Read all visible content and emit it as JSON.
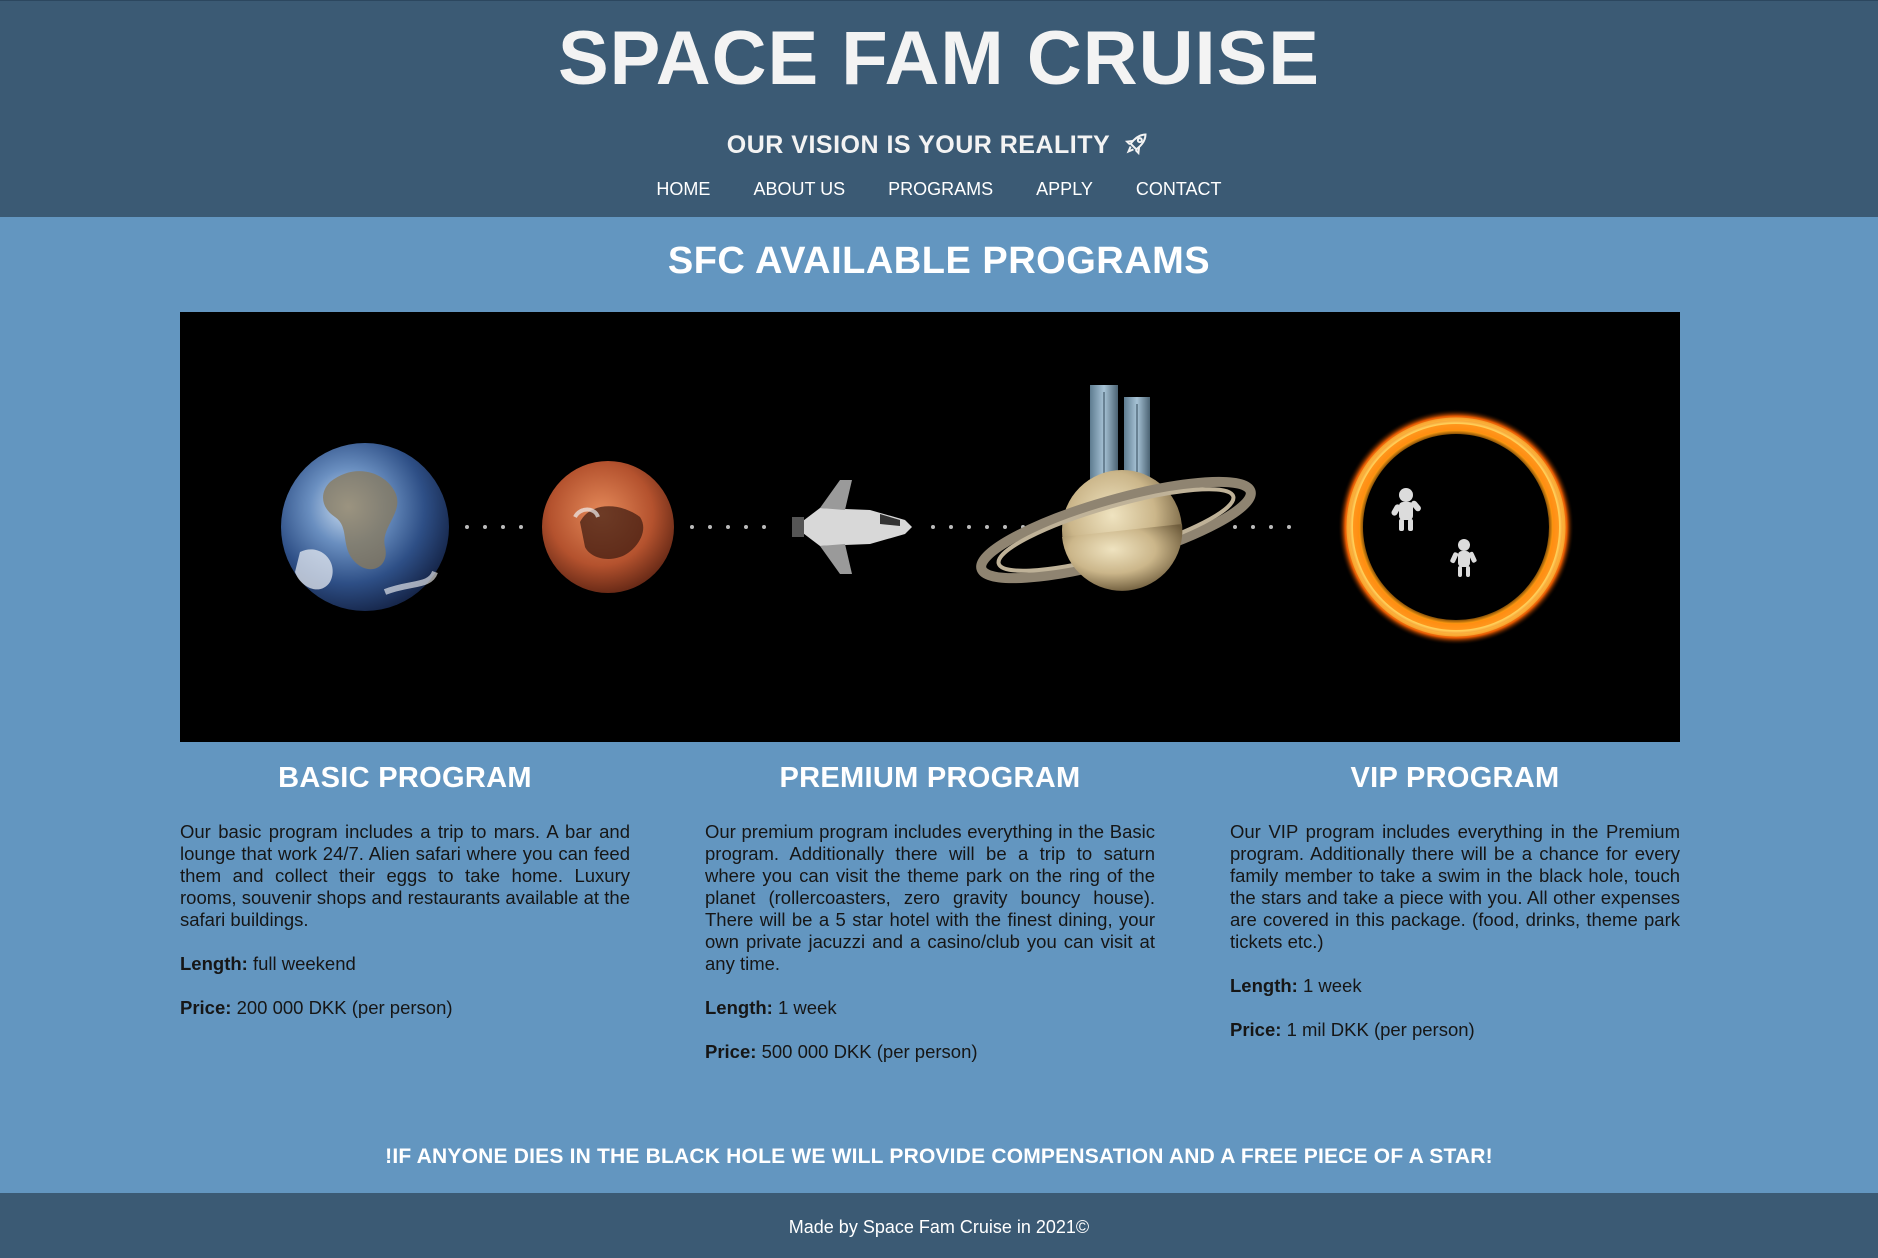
{
  "header": {
    "title": "SPACE FAM CRUISE",
    "tagline": "OUR VISION IS YOUR REALITY",
    "tagline_icon": "rocket-icon",
    "nav": [
      {
        "label": "HOME"
      },
      {
        "label": "ABOUT US"
      },
      {
        "label": "PROGRAMS"
      },
      {
        "label": "APPLY"
      },
      {
        "label": "CONTACT"
      }
    ]
  },
  "main": {
    "section_title": "SFC AVAILABLE PROGRAMS",
    "banner": {
      "stages": [
        "earth",
        "mars",
        "space-shuttle",
        "saturn-with-towers",
        "black-hole-with-astronauts"
      ]
    },
    "programs": [
      {
        "title": "BASIC PROGRAM",
        "description": "Our basic program includes a trip to mars. A bar and lounge that work 24/7. Alien safari where you can feed them and collect their eggs to take home. Luxury rooms, souvenir shops and restaurants available at the safari buildings.",
        "length_label": "Length:",
        "length": "full weekend",
        "price_label": "Price:",
        "price": "200 000 DKK (per person)"
      },
      {
        "title": "PREMIUM PROGRAM",
        "description": "Our premium program includes everything in the Basic program. Additionally there will be a trip to saturn where you can visit the theme park on the ring of the planet (rollercoasters, zero gravity bouncy house). There will be a 5 star hotel with the finest dining, your own private jacuzzi and a casino/club you can visit at any time.",
        "length_label": "Length:",
        "length": "1 week",
        "price_label": "Price:",
        "price": "500 000 DKK (per person)"
      },
      {
        "title": "VIP PROGRAM",
        "description": "Our VIP program includes everything in the Premium program. Additionally there will be a chance for every family member to take a swim in the black hole, touch the stars and take a piece with you. All other expenses are covered in this package. (food, drinks, theme park tickets etc.)",
        "length_label": "Length:",
        "length": "1 week",
        "price_label": "Price:",
        "price": "1 mil DKK (per person)"
      }
    ],
    "notice": "!IF ANYONE DIES IN THE BLACK HOLE WE WILL PROVIDE COMPENSATION AND A FREE PIECE OF A STAR!"
  },
  "footer": {
    "text": "Made by Space Fam Cruise in 2021©"
  },
  "colors": {
    "header_bg": "#3b5a74",
    "page_bg": "#6396c0",
    "banner_bg": "#000000",
    "heading_text": "#ffffff"
  }
}
